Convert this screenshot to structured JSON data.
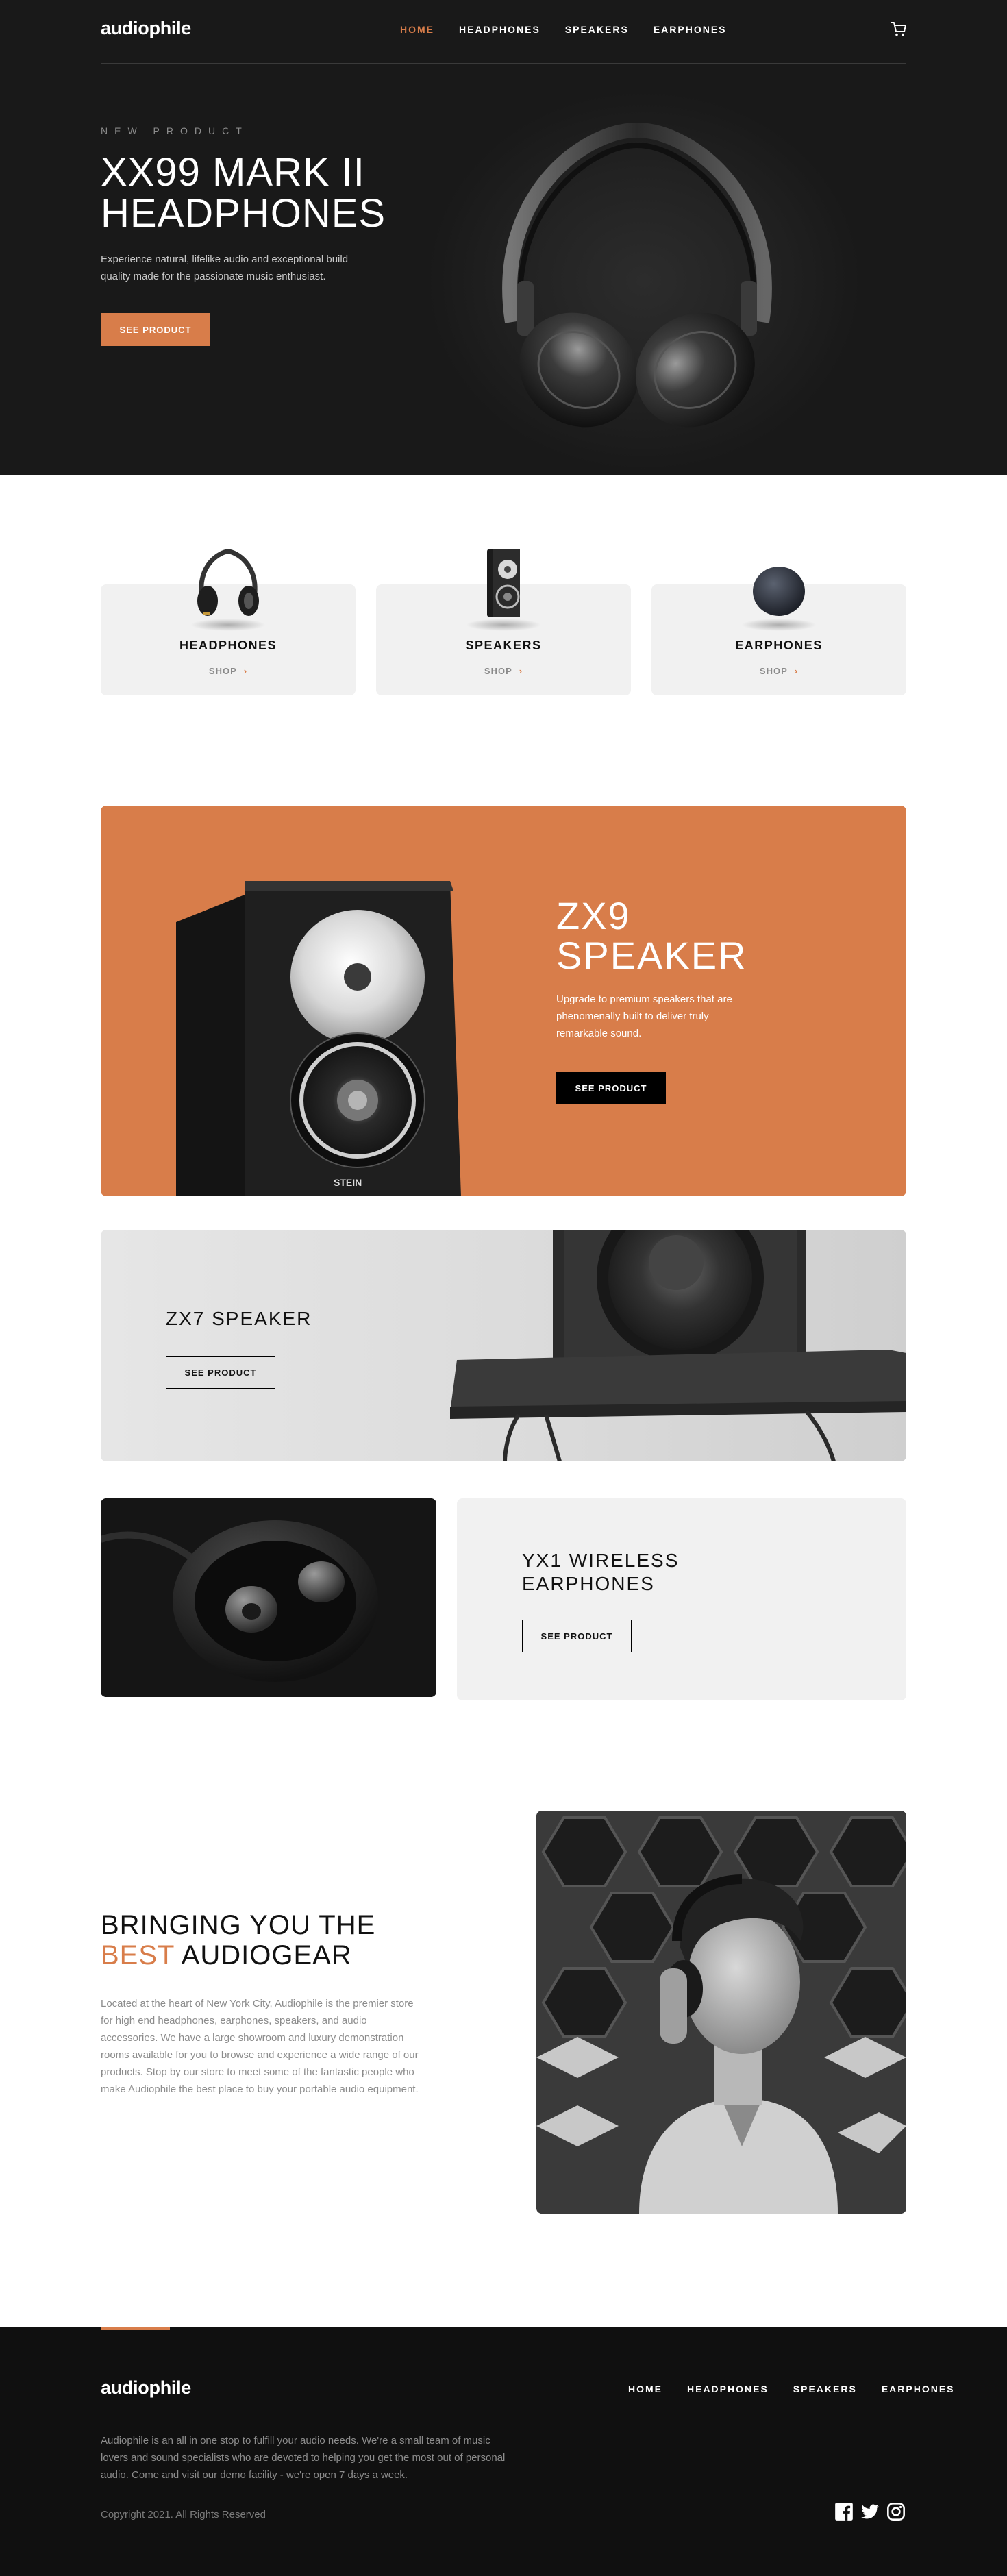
{
  "brand": {
    "logo": "audiophile",
    "accent": "#d87d4a",
    "dark": "#191919"
  },
  "nav": {
    "home": "HOME",
    "headphones": "HEADPHONES",
    "speakers": "SPEAKERS",
    "earphones": "EARPHONES"
  },
  "icons": {
    "cart": "cart-icon",
    "facebook": "facebook-icon",
    "twitter": "twitter-icon",
    "instagram": "instagram-icon",
    "chevron": "chevron-right-icon"
  },
  "hero": {
    "overline": "NEW PRODUCT",
    "title_line1": "XX99 MARK II",
    "title_line2": "HEADPHONES",
    "description": "Experience natural, lifelike audio and exceptional build quality made for the passionate music enthusiast.",
    "cta": "SEE PRODUCT"
  },
  "categories": [
    {
      "title": "HEADPHONES",
      "shop": "SHOP"
    },
    {
      "title": "SPEAKERS",
      "shop": "SHOP"
    },
    {
      "title": "EARPHONES",
      "shop": "SHOP"
    }
  ],
  "zx9": {
    "title_line1": "ZX9",
    "title_line2": "SPEAKER",
    "description": "Upgrade to premium speakers that are phenomenally built to deliver truly remarkable sound.",
    "cta": "SEE PRODUCT",
    "brand_mark": "STEIN"
  },
  "zx7": {
    "title": "ZX7 SPEAKER",
    "cta": "SEE PRODUCT"
  },
  "yx1": {
    "title_line1": "YX1 WIRELESS",
    "title_line2": "EARPHONES",
    "cta": "SEE PRODUCT"
  },
  "about": {
    "title_line1": "BRINGING YOU THE",
    "title_accent": "BEST",
    "title_rest": " AUDIOGEAR",
    "body": "Located at the heart of New York City, Audiophile is the premier store for high end headphones, earphones, speakers, and audio accessories. We have a large showroom and luxury demonstration rooms available for you to browse and experience a wide range of our products. Stop by our store to meet some of the fantastic people who make Audiophile the best place to buy your portable audio equipment."
  },
  "footer": {
    "logo": "audiophile",
    "description": "Audiophile is an all in one stop to fulfill your audio needs. We're a small team of music lovers and sound specialists who are devoted to helping you get the most out of personal audio. Come and visit our demo facility - we're open 7 days a week.",
    "copyright": "Copyright 2021. All Rights Reserved"
  }
}
